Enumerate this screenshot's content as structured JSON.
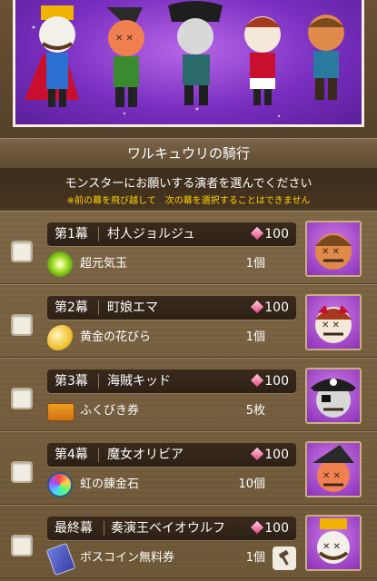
{
  "header": {
    "title": "ワルキュウリの騎行"
  },
  "instructions": {
    "main": "モンスターにお願いする演者を選んでください",
    "note": "※前の幕を飛び越して　次の幕を選択することはできません"
  },
  "acts": [
    {
      "act": "第1幕",
      "performer": "村人ジョルジュ",
      "cost": "100",
      "item": "超元気玉",
      "qty": "1個",
      "checked": false
    },
    {
      "act": "第2幕",
      "performer": "町娘エマ",
      "cost": "100",
      "item": "黄金の花びら",
      "qty": "1個",
      "checked": false
    },
    {
      "act": "第3幕",
      "performer": "海賊キッド",
      "cost": "100",
      "item": "ふくびき券",
      "qty": "5枚",
      "checked": false
    },
    {
      "act": "第4幕",
      "performer": "魔女オリビア",
      "cost": "100",
      "item": "虹の錬金石",
      "qty": "10個",
      "checked": false
    },
    {
      "act": "最終幕",
      "performer": "奏演王ベイオウルフ",
      "cost": "100",
      "item": "ボスコイン無料券",
      "qty": "1個",
      "checked": false
    }
  ],
  "colors": {
    "note": "#ffd200",
    "banner_bg": "#7a2fc0"
  },
  "icons": {
    "cost": "gem-icon",
    "items": [
      "genki-orb-icon",
      "golden-petal-icon",
      "lottery-ticket-icon",
      "rainbow-stone-icon",
      "boss-coin-ticket-icon"
    ],
    "extra": "hammer-icon"
  }
}
